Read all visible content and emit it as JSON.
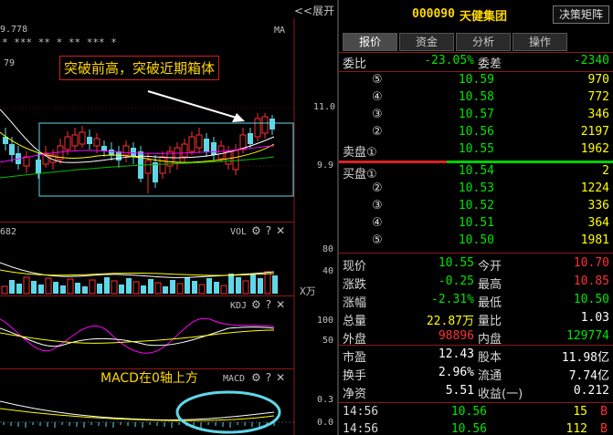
{
  "chart": {
    "expand_label": "<<展开",
    "top_partial_value": "9.778",
    "top_partial_value2": "79",
    "ma_label": "MA",
    "star_marks": "*   ***   ** * ** *** *",
    "annotation_text": "突破前高，突破近期箱体",
    "price_axis": [
      "11.0",
      "9.9"
    ],
    "vol_panel": {
      "title": "VOL",
      "partial_left": "682",
      "axis": [
        "80",
        "40"
      ],
      "unit": "X万"
    },
    "kdj_panel": {
      "title": "KDJ",
      "axis": [
        "100",
        "50"
      ]
    },
    "macd_panel": {
      "title": "MACD",
      "axis": [
        "0.3",
        "0.0"
      ],
      "note": "MACD在0轴上方"
    },
    "tool_icons": [
      "gear-icon",
      "help-icon",
      "close-icon"
    ],
    "tool_glyphs": {
      "gear": "⚙",
      "help": "?",
      "close": "✕"
    }
  },
  "quote": {
    "code": "000090",
    "name": "天健集团",
    "decision_button": "决策矩阵",
    "tabs": [
      {
        "label": "报价",
        "active": true
      },
      {
        "label": "资金",
        "active": false
      },
      {
        "label": "分析",
        "active": false
      },
      {
        "label": "操作",
        "active": false
      }
    ],
    "order_ratio": {
      "label1": "委比",
      "value1": "-23.05%",
      "label2": "委差",
      "value2": "-2340"
    },
    "asks": [
      {
        "level": "⑤",
        "price": "10.59",
        "volume": "970"
      },
      {
        "level": "④",
        "price": "10.58",
        "volume": "772"
      },
      {
        "level": "③",
        "price": "10.57",
        "volume": "346"
      },
      {
        "level": "②",
        "price": "10.56",
        "volume": "2197"
      },
      {
        "level": "卖盘①",
        "price": "10.55",
        "volume": "1962"
      }
    ],
    "bids": [
      {
        "level": "买盘①",
        "price": "10.54",
        "volume": "2"
      },
      {
        "level": "②",
        "price": "10.53",
        "volume": "1224"
      },
      {
        "level": "③",
        "price": "10.52",
        "volume": "336"
      },
      {
        "level": "④",
        "price": "10.51",
        "volume": "364"
      },
      {
        "level": "⑤",
        "price": "10.50",
        "volume": "1981"
      }
    ],
    "stats": [
      {
        "l1": "现价",
        "v1": "10.55",
        "c1": "green",
        "l2": "今开",
        "v2": "10.70",
        "c2": "red"
      },
      {
        "l1": "涨跌",
        "v1": "-0.25",
        "c1": "green",
        "l2": "最高",
        "v2": "10.85",
        "c2": "red"
      },
      {
        "l1": "涨幅",
        "v1": "-2.31%",
        "c1": "green",
        "l2": "最低",
        "v2": "10.50",
        "c2": "green"
      },
      {
        "l1": "总量",
        "v1": "22.87万",
        "c1": "yellow",
        "l2": "量比",
        "v2": "1.03",
        "c2": "white"
      },
      {
        "l1": "外盘",
        "v1": "98896",
        "c1": "red",
        "l2": "内盘",
        "v2": "129774",
        "c2": "green"
      }
    ],
    "fundamentals": [
      {
        "l1": "市盈",
        "v1": "12.43",
        "l2": "股本",
        "v2": "11.98亿"
      },
      {
        "l1": "换手",
        "v1": "2.96%",
        "l2": "流通",
        "v2": "7.74亿"
      },
      {
        "l1": "净资",
        "v1": "5.51",
        "l2": "收益(一)",
        "v2": "0.212"
      }
    ],
    "ticks": [
      {
        "time": "14:56",
        "price": "10.56",
        "volume": "15",
        "side": "B"
      },
      {
        "time": "14:56",
        "price": "10.56",
        "volume": "112",
        "side": "B"
      }
    ]
  },
  "colors": {
    "up": "#ff3030",
    "down": "#00e600",
    "box": "#5fd7e8",
    "ma_white": "#ffffff",
    "ma_yellow": "#ffff00",
    "ma_magenta": "#ff00ff",
    "ma_green": "#00c000"
  }
}
